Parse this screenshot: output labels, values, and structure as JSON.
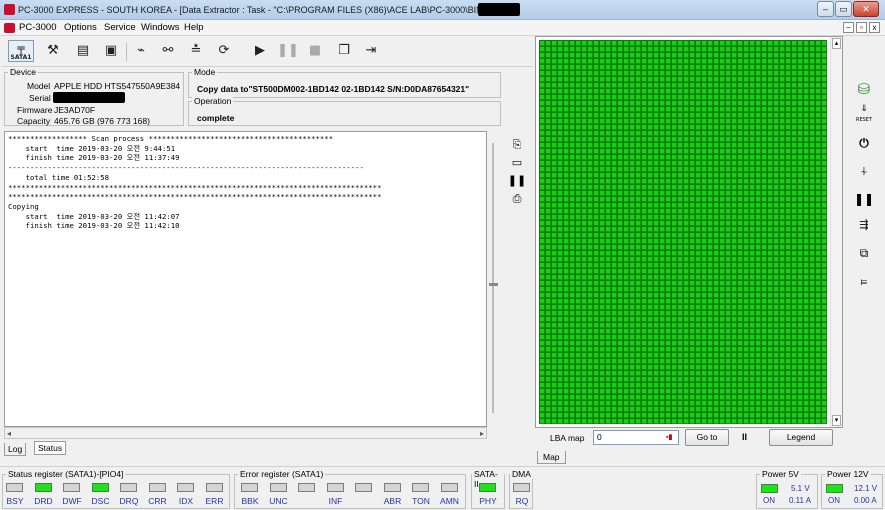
{
  "titlebar": {
    "title": "PC-3000 EXPRESS - SOUTH KOREA - [Data Extractor : Task - \"C:\\PROGRAM FILES (X86)\\ACE LAB\\PC-3000\\BIN\\TESK",
    "minimize": "–",
    "maximize": "▭",
    "close": "✕"
  },
  "menubar": {
    "app": "PC-3000",
    "items": [
      "Options",
      "Service",
      "Windows",
      "Help"
    ]
  },
  "toolbar": {
    "sata_label": "SATA1",
    "icons": [
      "sata-icon",
      "tools-icon",
      "scanner-icon",
      "chip-icon",
      "plug-icon",
      "binoculars-icon",
      "drive-icon",
      "reset-icon",
      "play-icon",
      "pause-icon",
      "stop-icon",
      "copy-icon",
      "exit-icon"
    ]
  },
  "device": {
    "group_label": "Device",
    "model_label": "Model",
    "model": "APPLE HDD HTS547550A9E384",
    "serial_label": "Serial",
    "firmware_label": "Firmware",
    "firmware": "JE3AD70F",
    "capacity_label": "Capacity",
    "capacity": "465.76 GB (976 773 168)"
  },
  "mode": {
    "group_label": "Mode",
    "value": "Copy data to\"ST500DM002-1BD142 02-1BD142 S/N:D0DA87654321\""
  },
  "operation": {
    "group_label": "Operation",
    "value": "complete"
  },
  "log": {
    "lines": [
      "****************** Scan process ******************************************",
      "    start  time 2019-03-20 오전 9:44:51",
      "    finish time 2019-03-20 오전 11:37:49",
      "---------------------------------------------------------------------------------",
      "    total time 01:52:58",
      "*************************************************************************************",
      "*************************************************************************************",
      "Copying",
      "    start  time 2019-03-20 오전 11:42:07",
      "    finish time 2019-03-20 오전 11:42:10"
    ],
    "tabs": [
      "Log",
      "Status"
    ]
  },
  "map": {
    "lba_label": "LBA map",
    "lba_value": "0",
    "goto_label": "Go to",
    "pause_label": "II",
    "legend_label": "Legend",
    "tab_label": "Map",
    "block_color": "#17d014",
    "block_border": "#0d7a0a"
  },
  "status_register": {
    "label": "Status register (SATA1)-[PIO4]",
    "leds": [
      {
        "name": "BSY",
        "on": false
      },
      {
        "name": "DRD",
        "on": true
      },
      {
        "name": "DWF",
        "on": false
      },
      {
        "name": "DSC",
        "on": true
      },
      {
        "name": "DRQ",
        "on": false
      },
      {
        "name": "CRR",
        "on": false
      },
      {
        "name": "IDX",
        "on": false
      },
      {
        "name": "ERR",
        "on": false
      }
    ]
  },
  "error_register": {
    "label": "Error register (SATA1)",
    "leds": [
      {
        "name": "BBK",
        "on": false
      },
      {
        "name": "UNC",
        "on": false
      },
      {
        "name": "",
        "on": false
      },
      {
        "name": "INF",
        "on": false
      },
      {
        "name": "",
        "on": false
      },
      {
        "name": "ABR",
        "on": false
      },
      {
        "name": "TON",
        "on": false
      },
      {
        "name": "AMN",
        "on": false
      }
    ]
  },
  "sata2": {
    "label": "SATA-II",
    "led": "PHY",
    "on": true
  },
  "dma": {
    "label": "DMA",
    "led": "RQ",
    "on": false
  },
  "power5": {
    "label": "Power 5V",
    "voltage": "5.1 V",
    "current": "0.11 A",
    "state": "ON"
  },
  "power12": {
    "label": "Power 12V",
    "voltage": "12.1 V",
    "current": "0.00 A",
    "state": "ON"
  }
}
